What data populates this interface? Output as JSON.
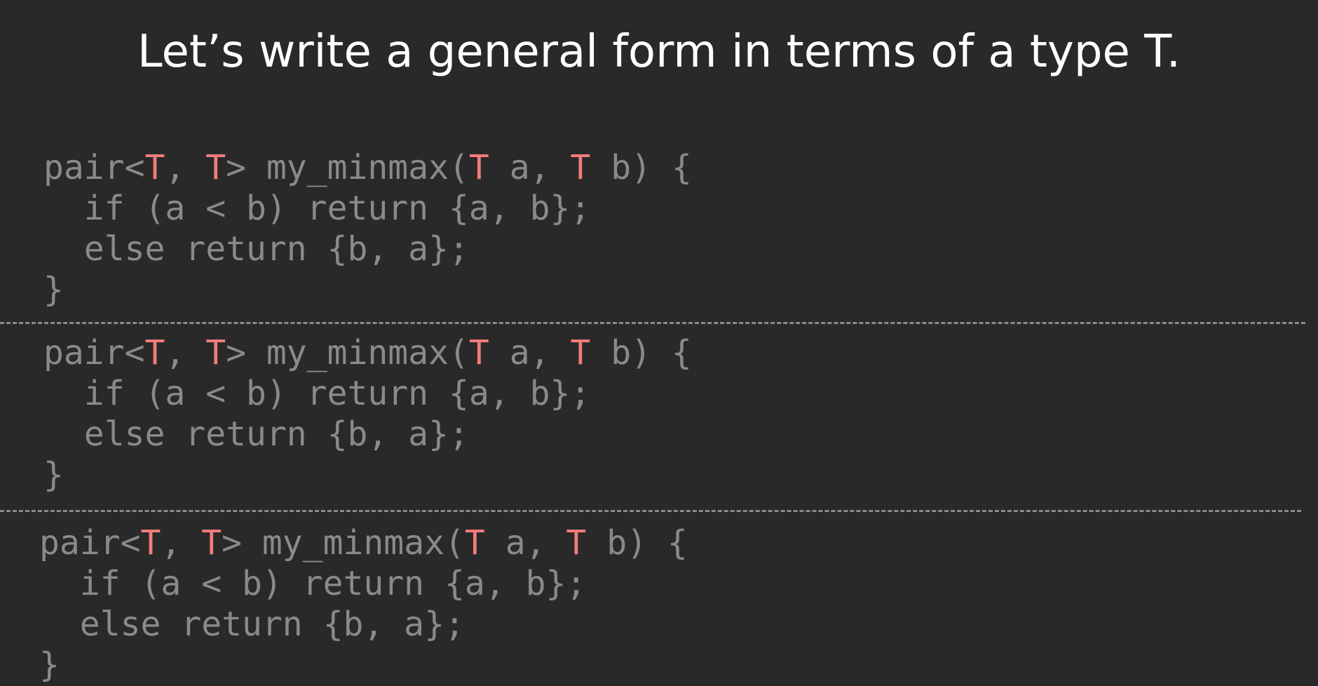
{
  "title": "Let’s write a general form in terms of a type T.",
  "code_blocks": [
    {
      "lines": [
        {
          "segments": [
            {
              "text": "pair<",
              "type": "plain"
            },
            {
              "text": "T",
              "type": "param"
            },
            {
              "text": ", ",
              "type": "plain"
            },
            {
              "text": "T",
              "type": "param"
            },
            {
              "text": "> my_minmax(",
              "type": "plain"
            },
            {
              "text": "T",
              "type": "param"
            },
            {
              "text": " a, ",
              "type": "plain"
            },
            {
              "text": "T",
              "type": "param"
            },
            {
              "text": " b) {",
              "type": "plain"
            }
          ]
        },
        {
          "segments": [
            {
              "text": "  if (a < b) return {a, b};",
              "type": "plain"
            }
          ]
        },
        {
          "segments": [
            {
              "text": "  else return {b, a};",
              "type": "plain"
            }
          ]
        },
        {
          "segments": [
            {
              "text": "}",
              "type": "plain"
            }
          ]
        }
      ]
    },
    {
      "lines": [
        {
          "segments": [
            {
              "text": "pair<",
              "type": "plain"
            },
            {
              "text": "T",
              "type": "param"
            },
            {
              "text": ", ",
              "type": "plain"
            },
            {
              "text": "T",
              "type": "param"
            },
            {
              "text": "> my_minmax(",
              "type": "plain"
            },
            {
              "text": "T",
              "type": "param"
            },
            {
              "text": " a, ",
              "type": "plain"
            },
            {
              "text": "T",
              "type": "param"
            },
            {
              "text": " b) {",
              "type": "plain"
            }
          ]
        },
        {
          "segments": [
            {
              "text": "  if (a < b) return {a, b};",
              "type": "plain"
            }
          ]
        },
        {
          "segments": [
            {
              "text": "  else return {b, a};",
              "type": "plain"
            }
          ]
        },
        {
          "segments": [
            {
              "text": "}",
              "type": "plain"
            }
          ]
        }
      ]
    },
    {
      "lines": [
        {
          "segments": [
            {
              "text": "pair<",
              "type": "plain"
            },
            {
              "text": "T",
              "type": "param"
            },
            {
              "text": ", ",
              "type": "plain"
            },
            {
              "text": "T",
              "type": "param"
            },
            {
              "text": "> my_minmax(",
              "type": "plain"
            },
            {
              "text": "T",
              "type": "param"
            },
            {
              "text": " a, ",
              "type": "plain"
            },
            {
              "text": "T",
              "type": "param"
            },
            {
              "text": " b) {",
              "type": "plain"
            }
          ]
        },
        {
          "segments": [
            {
              "text": "  if (a < b) return {a, b};",
              "type": "plain"
            }
          ]
        },
        {
          "segments": [
            {
              "text": "  else return {b, a};",
              "type": "plain"
            }
          ]
        },
        {
          "segments": [
            {
              "text": "}",
              "type": "plain"
            }
          ]
        }
      ]
    }
  ],
  "colors": {
    "background": "#292929",
    "title": "#ffffff",
    "code": "#8a8a8a",
    "type_param": "#f27c7c",
    "divider": "#8a8a8a"
  }
}
